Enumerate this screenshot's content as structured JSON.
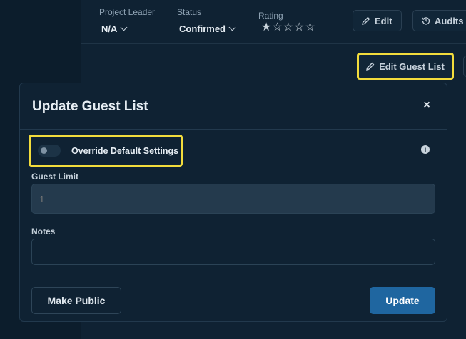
{
  "background": {
    "project_leader_label": "Project Leader",
    "project_leader_value": "N/A",
    "status_label": "Status",
    "status_value": "Confirmed",
    "rating_label": "Rating",
    "rating_value": 1,
    "rating_max": 5,
    "edit_label": "Edit",
    "audits_label": "Audits",
    "edit_guest_list_label": "Edit Guest List"
  },
  "modal": {
    "title": "Update Guest List",
    "close_glyph": "×",
    "override_label": "Override Default Settings",
    "override_enabled": false,
    "guest_limit_label": "Guest Limit",
    "guest_limit_placeholder": "1",
    "guest_limit_value": "",
    "notes_label": "Notes",
    "notes_value": "",
    "make_public_label": "Make Public",
    "update_label": "Update"
  },
  "colors": {
    "highlight": "#f2dc3c",
    "primary_button": "#1f66a0",
    "background": "#0c1d2c"
  }
}
